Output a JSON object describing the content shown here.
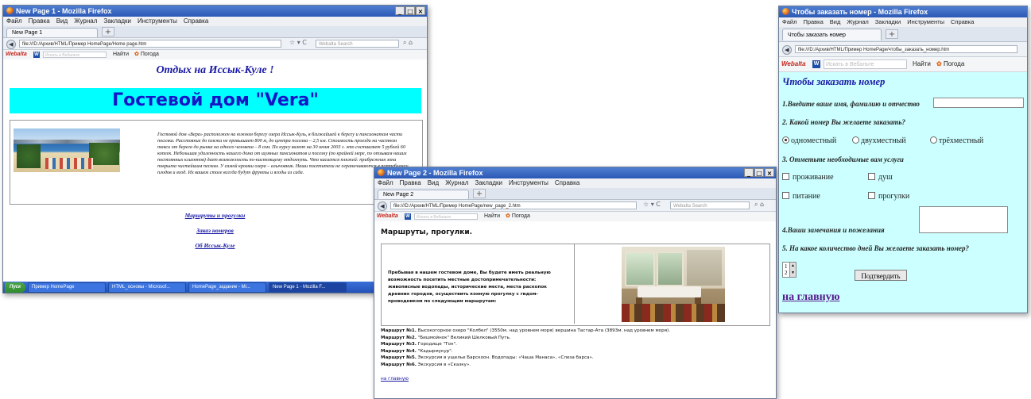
{
  "w1": {
    "title": "New Page 1 - Mozilla Firefox",
    "menu": [
      "Файл",
      "Правка",
      "Вид",
      "Журнал",
      "Закладки",
      "Инструменты",
      "Справка"
    ],
    "tab": "New Page 1",
    "url": "file:///D:/Архив/HTML/Пример HomePage/Home page.htm",
    "search_placeholder": "Webalta Search",
    "webalta_logo": "Webalta",
    "webalta_placeholder": "Искать в Вебальте",
    "find": "Найти",
    "weather": "Погода",
    "heading": "Отдых на Иссык-Куле !",
    "banner": "Гостевой дом \"Vera\"",
    "paragraph": "Гостевой дом «Вера» расположен на южном берегу озера Иссык-Куль, в ближайшей к берегу и пансионатам части поселка. Расстояние до пляжа не превышает 800 м, до центра поселка – 2,5 км. Стоимость проезда на частном такси от берега до рынка на одного человека – 8 сом. По курсу валют на 30 июня 2003 г. это составляет 5 рублей 60 копеек. Небольшая удаленность нашего дома от шумных пансионатов и поселку (по крайней мере, по отзывам наших постоянных клиентов) дает возможность по-настоящему отдохнуть. Что касается пляжей: прибрежная зона покрыта чистейшим песком. У самой кромки озера – алычовник. Наши посетители не ограничиваются в потреблении плодов и ягод. Их вашем столе всегда будут фрукты и ягоды из сада.",
    "links": [
      "Маршруты и прогулки",
      "Заказ номеров",
      "Об Иссык-Куле"
    ],
    "taskbar": {
      "start": "Пуск",
      "items": [
        "Пример HomePage",
        "HTML_основы - Microsof...",
        "HomePage_задание - Mi...",
        "New Page 1 - Mozilla F..."
      ]
    }
  },
  "w2": {
    "title": "New Page 2 - Mozilla Firefox",
    "menu": [
      "Файл",
      "Правка",
      "Вид",
      "Журнал",
      "Закладки",
      "Инструменты",
      "Справка"
    ],
    "tab": "New Page 2",
    "url": "file:///D:/Архив/HTML/Пример HomePage/new_page_2.htm",
    "search_placeholder": "Webalta Search",
    "webalta_logo": "Webalta",
    "webalta_placeholder": "Искать в Вебальте",
    "find": "Найти",
    "weather": "Погода",
    "heading": "Маршруты, прогулки.",
    "cell_text": "Пребывая в нашем гостевом доме, Вы будете иметь реальную возможность посетить местные достопримечательности: живописные водопады, исторические места, места раскопок древних городов, осуществить конную прогулку с гидом-проводником по следующим маршрутам:",
    "routes": [
      {
        "label": "Маршрут №1.",
        "text": "Высокогорное озеро \"Колбел\" (3550м. над уровнем моря) вершина Тастар-Ата (3893м. над уровнем моря)."
      },
      {
        "label": "Маршрут №2.",
        "text": "\"Бишмойнок\" Великий Шелковый Путь."
      },
      {
        "label": "Маршрут №3.",
        "text": "Городище \"Тон\"."
      },
      {
        "label": "Маршрут №4.",
        "text": "\"Кадырмукур\"."
      },
      {
        "label": "Маршрут №5.",
        "text": "Экскурсия в ущелье Барскоон. Водопады: «Чаша Манаса», «Слеза барса»."
      },
      {
        "label": "Маршрут №6.",
        "text": "Экскурсия в «Сказку»."
      }
    ],
    "home_link": "на главную"
  },
  "w3": {
    "title": "Чтобы заказать номер - Mozilla Firefox",
    "menu": [
      "Файл",
      "Правка",
      "Вид",
      "Журнал",
      "Закладки",
      "Инструменты",
      "Справка"
    ],
    "tab": "Чтобы заказать номер",
    "url": "file:///D:/Архив/HTML/Пример HomePage/чтобы_заказать_номер.htm",
    "webalta_logo": "Webalta",
    "webalta_placeholder": "Искать в Вебальте",
    "find": "Найти",
    "weather": "Погода",
    "heading": "Чтобы заказать номер",
    "q1": "1.Введите ваше имя, фамилию и отчество",
    "q2": "2. Какой номер Вы желаете заказать?",
    "radios": [
      "одноместный",
      "двухместный",
      "трёхместный"
    ],
    "q3": "3. Отметьте необходимые вам услуги",
    "checks": [
      "проживание",
      "душ",
      "питание",
      "прогулки"
    ],
    "q4": "4.Ваши замечания и пожелания",
    "q5": "5. На какое количество дней Вы желаете заказать номер?",
    "spin_values": [
      "1",
      "2"
    ],
    "submit": "Подтвердить",
    "home_link": "на главную"
  },
  "colors": {
    "titlebar": "#2b58b5",
    "banner_bg": "#00ffff",
    "banner_text": "#1515c8",
    "form_bg": "#ccffff",
    "heading_blue": "#1a1aa6"
  }
}
